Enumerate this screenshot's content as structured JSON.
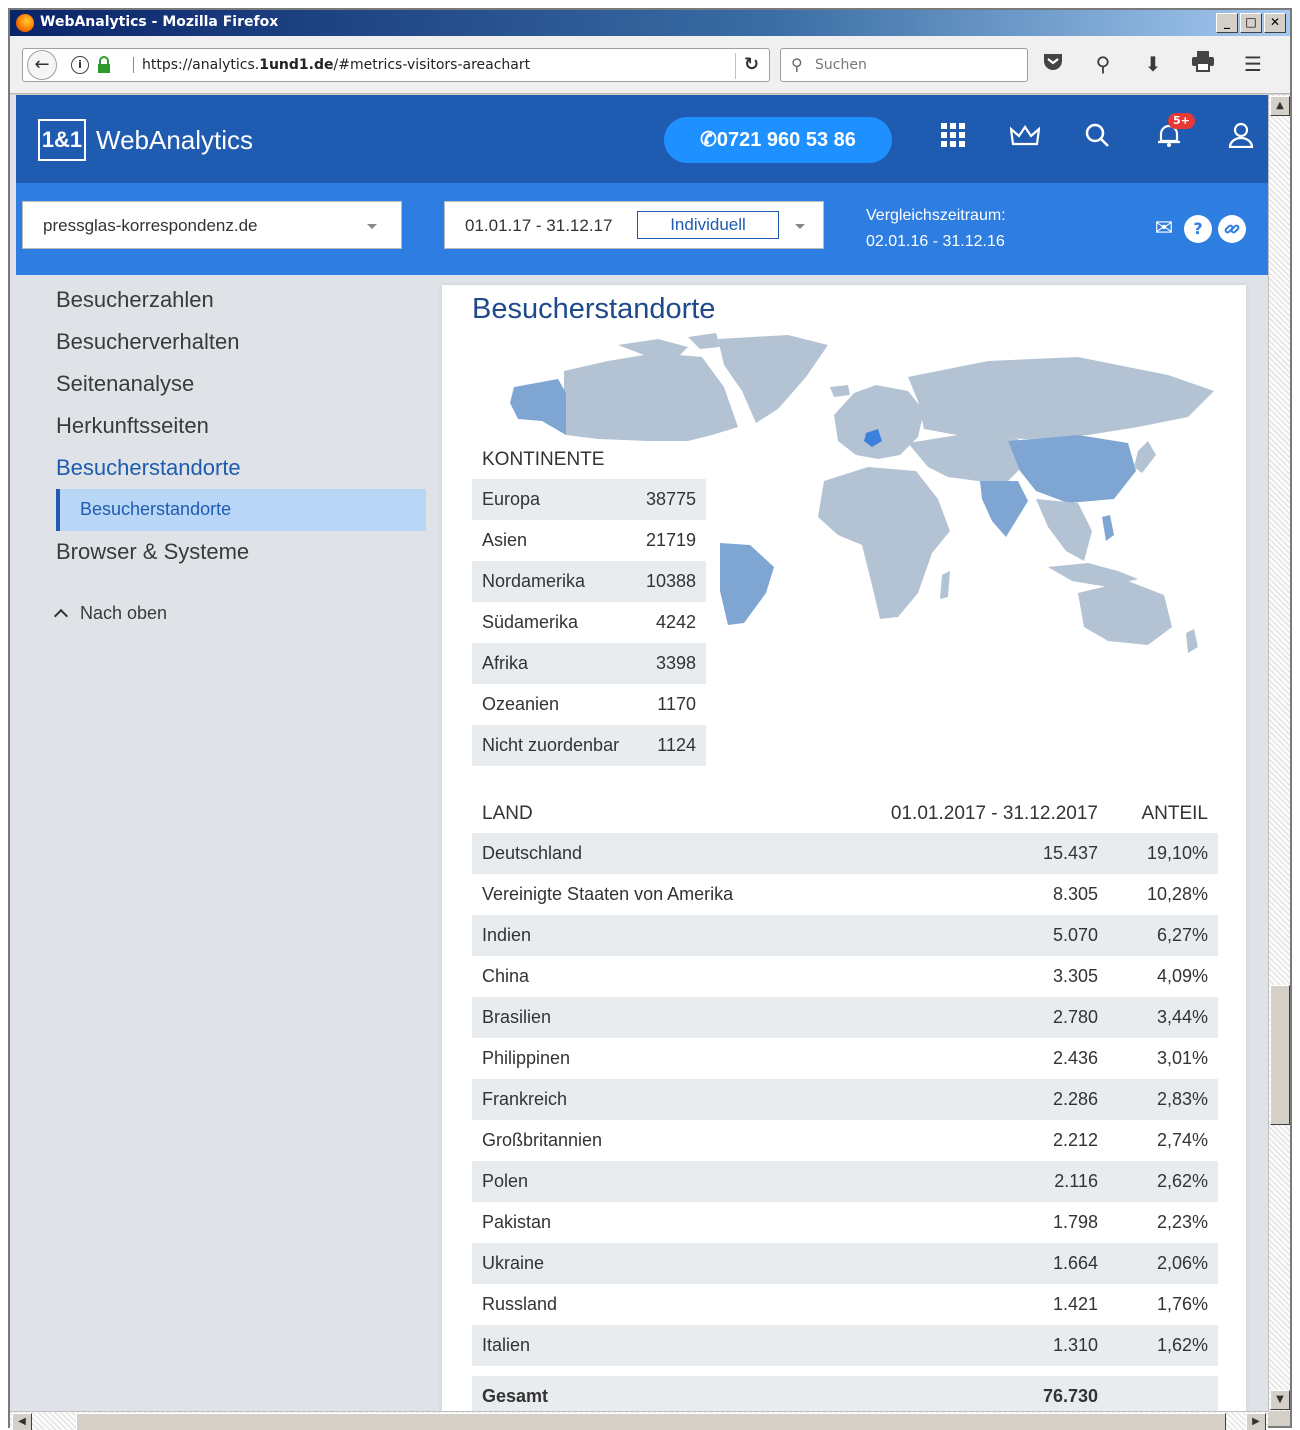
{
  "browser": {
    "title": "WebAnalytics - Mozilla Firefox",
    "url_prefix": "https://analytics.",
    "url_domain": "1und1.de",
    "url_suffix": "/#metrics-visitors-areachart",
    "search_placeholder": "Suchen"
  },
  "header": {
    "logo_box": "1&1",
    "logo_text": "WebAnalytics",
    "phone": "0721 960 53 86",
    "notification_badge": "5+"
  },
  "subheader": {
    "domain": "pressglas-korrespondenz.de",
    "date_range": "01.01.17 - 31.12.17",
    "mode_button": "Individuell",
    "compare_label": "Vergleichszeitraum:",
    "compare_range": "02.01.16 - 31.12.16"
  },
  "sidebar": {
    "items": [
      {
        "label": "Besucherzahlen"
      },
      {
        "label": "Besucherverhalten"
      },
      {
        "label": "Seitenanalyse"
      },
      {
        "label": "Herkunftsseiten"
      },
      {
        "label": "Besucherstandorte"
      },
      {
        "label": "Browser & Systeme"
      }
    ],
    "active_sub": "Besucherstandorte",
    "back_to_top": "Nach oben"
  },
  "main": {
    "title": "Besucherstandorte",
    "continents_header": "KONTINENTE",
    "continents": [
      {
        "name": "Europa",
        "value": "38775"
      },
      {
        "name": "Asien",
        "value": "21719"
      },
      {
        "name": "Nordamerika",
        "value": "10388"
      },
      {
        "name": "Südamerika",
        "value": "4242"
      },
      {
        "name": "Afrika",
        "value": "3398"
      },
      {
        "name": "Ozeanien",
        "value": "1170"
      },
      {
        "name": "Nicht zuordenbar",
        "value": "1124"
      }
    ],
    "countries_header": {
      "land": "LAND",
      "period": "01.01.2017 - 31.12.2017",
      "share": "ANTEIL"
    },
    "countries": [
      {
        "name": "Deutschland",
        "value": "15.437",
        "share": "19,10%"
      },
      {
        "name": "Vereinigte Staaten von Amerika",
        "value": "8.305",
        "share": "10,28%"
      },
      {
        "name": "Indien",
        "value": "5.070",
        "share": "6,27%"
      },
      {
        "name": "China",
        "value": "3.305",
        "share": "4,09%"
      },
      {
        "name": "Brasilien",
        "value": "2.780",
        "share": "3,44%"
      },
      {
        "name": "Philippinen",
        "value": "2.436",
        "share": "3,01%"
      },
      {
        "name": "Frankreich",
        "value": "2.286",
        "share": "2,83%"
      },
      {
        "name": "Großbritannien",
        "value": "2.212",
        "share": "2,74%"
      },
      {
        "name": "Polen",
        "value": "2.116",
        "share": "2,62%"
      },
      {
        "name": "Pakistan",
        "value": "1.798",
        "share": "2,23%"
      },
      {
        "name": "Ukraine",
        "value": "1.664",
        "share": "2,06%"
      },
      {
        "name": "Russland",
        "value": "1.421",
        "share": "1,76%"
      },
      {
        "name": "Italien",
        "value": "1.310",
        "share": "1,62%"
      }
    ],
    "total_label": "Gesamt",
    "total_value": "76.730"
  },
  "colors": {
    "header_blue": "#1e5bb1",
    "subheader_blue": "#2e7de0",
    "phone_button": "#1e90ff",
    "map_land": "#b3c3d4",
    "map_highlight": "#7fa6d3",
    "map_germany": "#3d7fdc"
  }
}
